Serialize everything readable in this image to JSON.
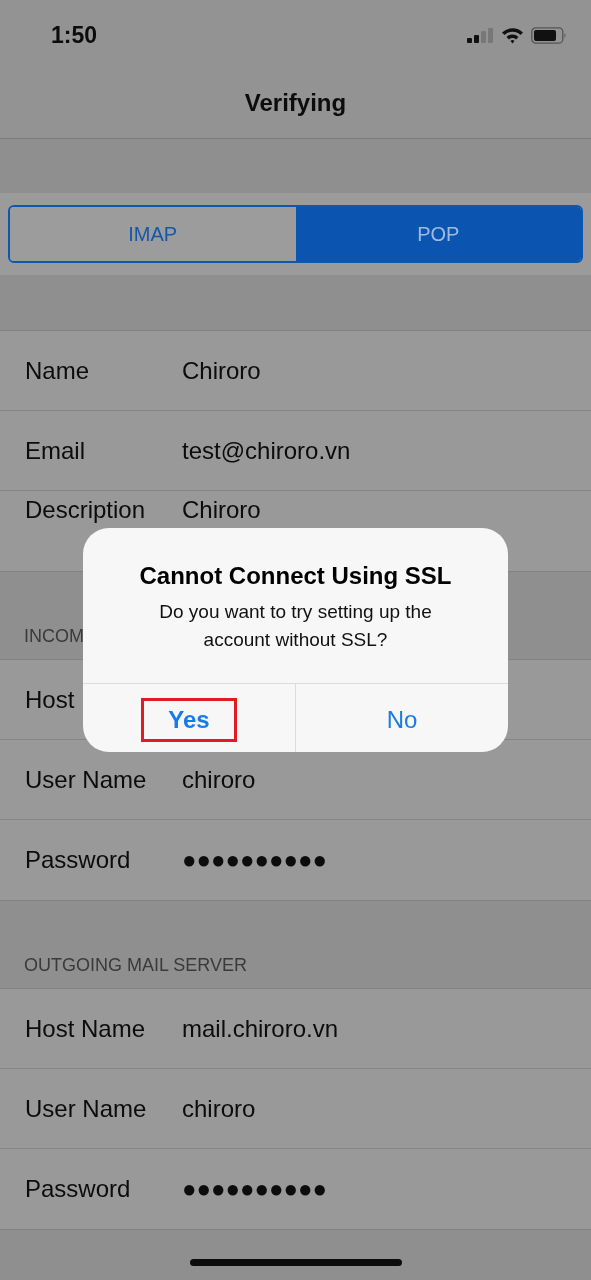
{
  "status_bar": {
    "time": "1:50"
  },
  "nav": {
    "title": "Verifying"
  },
  "segments": [
    {
      "label": "IMAP",
      "selected": false
    },
    {
      "label": "POP",
      "selected": true
    }
  ],
  "sections": [
    {
      "rows": [
        {
          "label": "Name",
          "value": "Chiroro"
        },
        {
          "label": "Email",
          "value": "test@chiroro.vn"
        },
        {
          "label": "Description",
          "value": "Chiroro"
        }
      ]
    },
    {
      "header": "INCOM",
      "rows": [
        {
          "label": "Host"
        },
        {
          "label": "User Name",
          "value": "chiroro"
        },
        {
          "label": "Password",
          "value": "●●●●●●●●●●"
        }
      ]
    },
    {
      "header": "OUTGOING MAIL SERVER",
      "rows": [
        {
          "label": "Host Name",
          "value": "mail.chiroro.vn"
        },
        {
          "label": "User Name",
          "value": "chiroro"
        },
        {
          "label": "Password",
          "value": "●●●●●●●●●●"
        }
      ]
    }
  ],
  "alert": {
    "title": "Cannot Connect Using SSL",
    "message": "Do you want to try setting up the account without SSL?",
    "buttons": [
      {
        "label": "Yes",
        "highlighted": true
      },
      {
        "label": "No",
        "highlighted": false
      }
    ]
  }
}
